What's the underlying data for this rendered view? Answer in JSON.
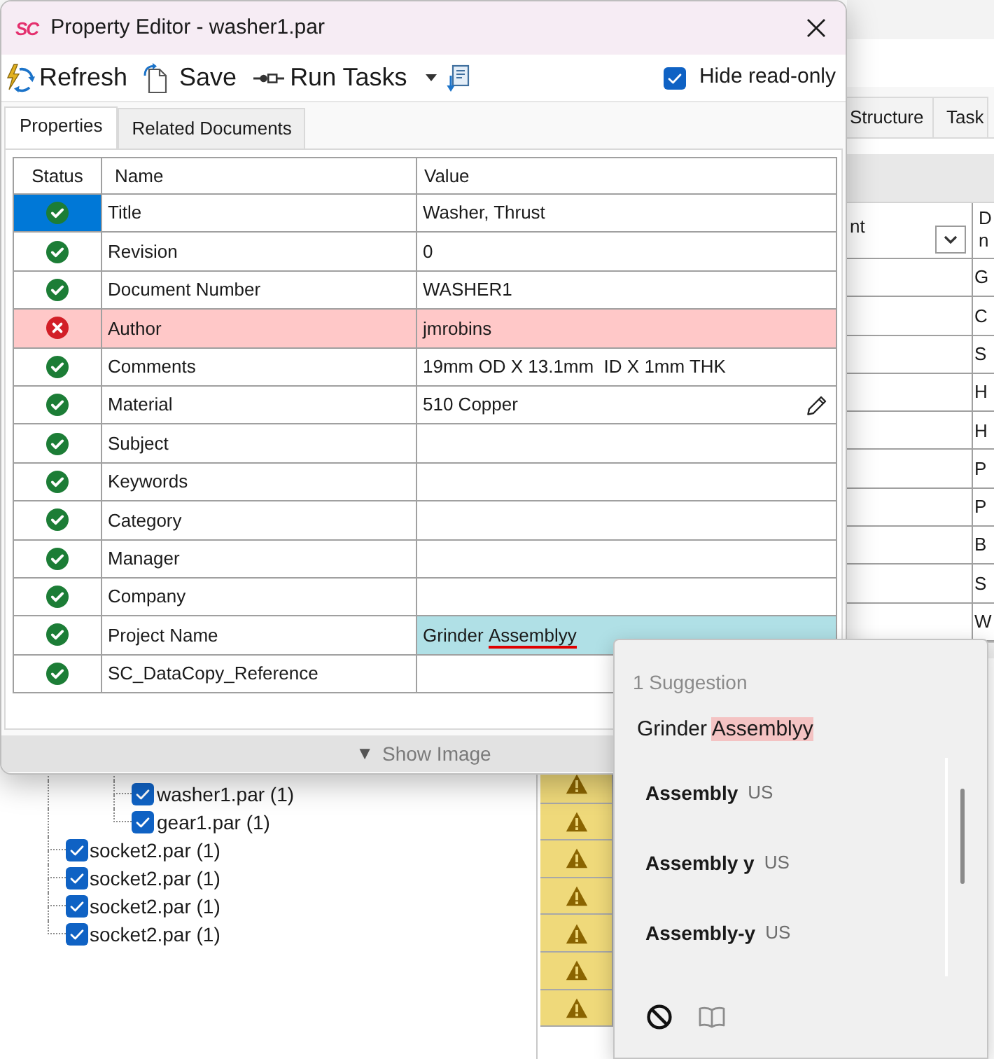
{
  "background_window": {
    "tabs": [
      {
        "label": "Structure",
        "selected": false
      },
      {
        "label": "Task",
        "selected": false
      }
    ],
    "grid": {
      "columns": [
        "nt",
        "D n"
      ],
      "rows": [
        {
          "column_2": "G"
        },
        {
          "column_2": "C"
        },
        {
          "column_2": "S"
        },
        {
          "column_2": "H"
        },
        {
          "column_2": "H"
        },
        {
          "column_2": "P"
        },
        {
          "column_2": "P"
        },
        {
          "column_2": "B"
        },
        {
          "column_2": "S"
        },
        {
          "column_2": "W"
        }
      ]
    },
    "tree": {
      "items": [
        {
          "children": [
            {
              "label": "washer1.par (1)",
              "checked": true
            },
            {
              "label": "gear1.par (1)",
              "checked": true
            }
          ]
        },
        {
          "label": "socket2.par (1)",
          "checked": true
        },
        {
          "label": "socket2.par (1)",
          "checked": true
        },
        {
          "label": "socket2.par (1)",
          "checked": true
        },
        {
          "label": "socket2.par (1)",
          "checked": true
        }
      ]
    },
    "status_cells": [
      {
        "kind": "warning"
      },
      {
        "kind": "warning"
      },
      {
        "kind": "warning"
      },
      {
        "kind": "warning"
      },
      {
        "kind": "warning"
      },
      {
        "kind": "warning"
      },
      {
        "kind": "warning"
      }
    ]
  },
  "property_editor": {
    "logo": "SC",
    "title": "Property Editor - washer1.par",
    "toolbar": [
      {
        "kind": "refresh",
        "label": "Refresh"
      },
      {
        "kind": "save",
        "label": "Save"
      },
      {
        "kind": "run",
        "label": "Run Tasks"
      }
    ],
    "hide_read_only": {
      "label": "Hide read-only",
      "checked": true
    },
    "tabs": [
      {
        "label": "Properties",
        "selected": true
      },
      {
        "label": "Related Documents",
        "selected": false
      }
    ],
    "table": {
      "columns": [
        "Status",
        "Name",
        "Value"
      ],
      "rows": [
        {
          "error": false,
          "name": "Title",
          "value": "Washer, Thrust",
          "selected": true,
          "editing": false,
          "edit_icon": false
        },
        {
          "error": false,
          "name": "Revision",
          "value": "0",
          "selected": false,
          "editing": false,
          "edit_icon": false
        },
        {
          "error": false,
          "name": "Document Number",
          "value": "WASHER1",
          "selected": false,
          "editing": false,
          "edit_icon": false
        },
        {
          "error": true,
          "name": "Author",
          "value": "jmrobins",
          "selected": false,
          "editing": false,
          "edit_icon": false
        },
        {
          "error": false,
          "name": "Comments",
          "value": "19mm OD X 13.1mm  ID X 1mm THK",
          "selected": false,
          "editing": false,
          "edit_icon": false
        },
        {
          "error": false,
          "name": "Material",
          "value": "510 Copper",
          "selected": false,
          "editing": false,
          "edit_icon": true
        },
        {
          "error": false,
          "name": "Subject",
          "selected": false,
          "editing": false,
          "edit_icon": false
        },
        {
          "error": false,
          "name": "Keywords",
          "selected": false,
          "editing": false,
          "edit_icon": false
        },
        {
          "error": false,
          "name": "Category",
          "selected": false,
          "editing": false,
          "edit_icon": false
        },
        {
          "error": false,
          "name": "Manager",
          "selected": false,
          "editing": false,
          "edit_icon": false
        },
        {
          "error": false,
          "name": "Company",
          "selected": false,
          "editing": false,
          "edit_icon": false
        },
        {
          "error": false,
          "name": "Project Name",
          "value_words": [
            {
              "text": "Grinder",
              "misspelled": false
            },
            {
              "text": "Assemblyy",
              "misspelled": true
            }
          ],
          "selected": false,
          "editing": true,
          "edit_icon": false
        },
        {
          "error": false,
          "name": "SC_DataCopy_Reference",
          "selected": false,
          "editing": false,
          "edit_icon": false
        }
      ]
    },
    "show_image": {
      "icon": "▼",
      "label": "Show Image"
    }
  },
  "spelling_popup": {
    "title": "1 Suggestion",
    "context_words": [
      {
        "text": "Grinder",
        "flagged": false
      },
      {
        "text": "Assemblyy",
        "flagged": true
      }
    ],
    "suggestions": [
      {
        "word": "Assembly",
        "language": "US"
      },
      {
        "word": "Assembly y",
        "language": "US"
      },
      {
        "word": "Assembly-y",
        "language": "US"
      }
    ]
  }
}
